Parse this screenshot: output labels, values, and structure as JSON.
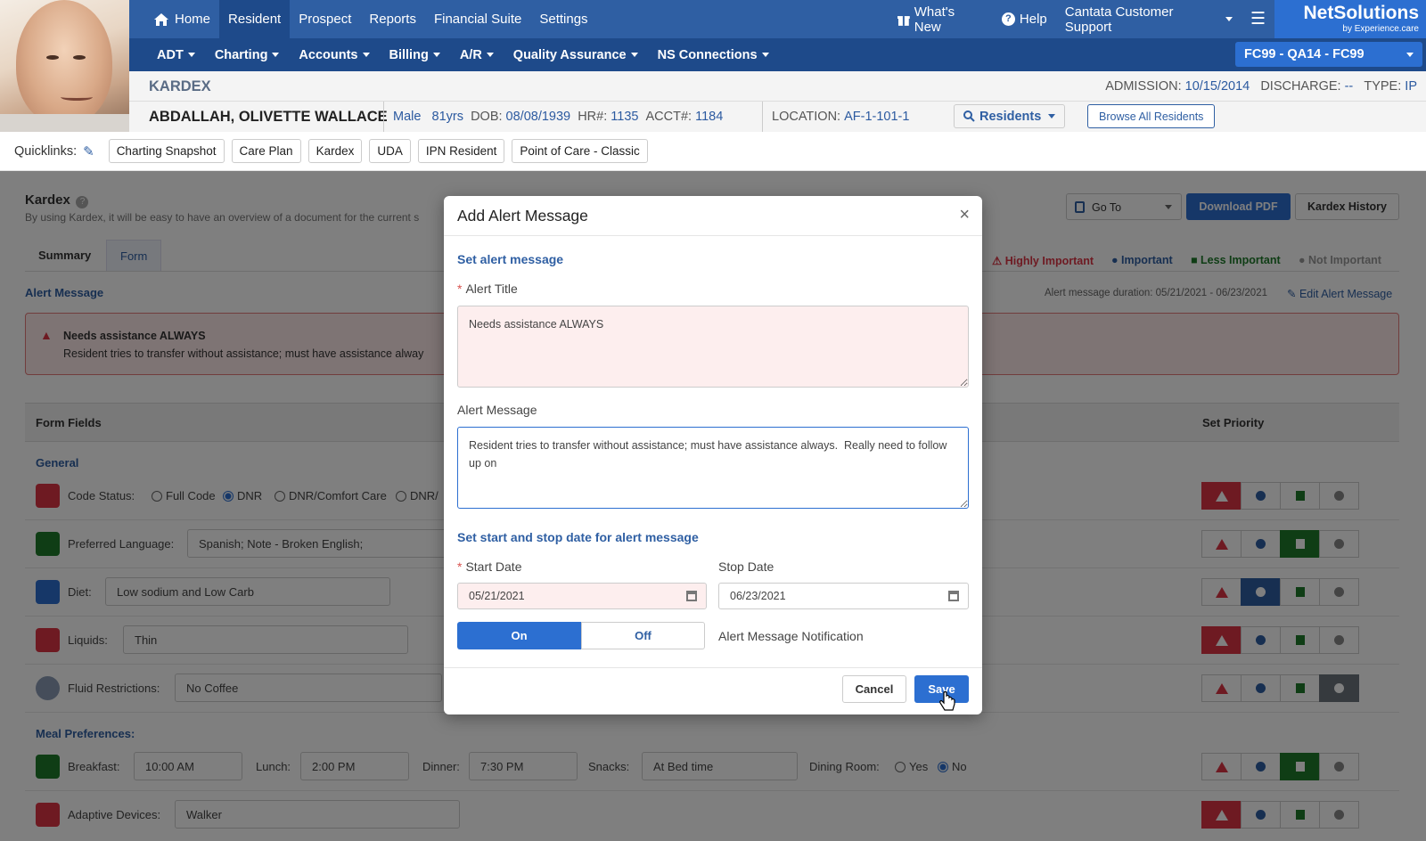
{
  "nav": {
    "top": [
      "Home",
      "Resident",
      "Prospect",
      "Reports",
      "Financial Suite",
      "Settings"
    ],
    "right": {
      "whats_new": "What's New",
      "help": "Help",
      "support": "Cantata Customer Support"
    },
    "sub": [
      "ADT",
      "Charting",
      "Accounts",
      "Billing",
      "A/R",
      "Quality Assurance",
      "NS Connections"
    ]
  },
  "logo": {
    "main": "NetSolutions",
    "sub": "by Experience.care"
  },
  "facility": "FC99 - QA14 - FC99",
  "kardex": {
    "title": "KARDEX",
    "admission_label": "ADMISSION:",
    "admission": "10/15/2014",
    "discharge_label": "DISCHARGE:",
    "discharge": "--",
    "type_label": "TYPE:",
    "type": "IP"
  },
  "patient": {
    "name": "ABDALLAH, OLIVETTE WALLACE",
    "sex": "Male",
    "age": "81yrs",
    "dob_label": "DOB:",
    "dob": "08/08/1939",
    "hr_label": "HR#:",
    "hr": "1135",
    "acct_label": "ACCT#:",
    "acct": "1184",
    "loc_label": "LOCATION:",
    "loc": "AF-1-101-1",
    "residents_btn": "Residents",
    "browse_btn": "Browse All Residents"
  },
  "quicklinks": {
    "label": "Quicklinks:",
    "items": [
      "Charting Snapshot",
      "Care Plan",
      "Kardex",
      "UDA",
      "IPN Resident",
      "Point of Care - Classic"
    ]
  },
  "page": {
    "title": "Kardex",
    "desc": "By using Kardex, it will be easy to have an overview of a document for the current s",
    "goto": "Go To",
    "download": "Download PDF",
    "history": "Kardex History",
    "tabs": [
      "Summary",
      "Form"
    ],
    "legend": [
      "Highly Important",
      "Important",
      "Less Important",
      "Not Important"
    ],
    "alert_section": "Alert Message",
    "duration": "Alert message duration: 05/21/2021 - 06/23/2021",
    "edit_alert": "Edit Alert Message",
    "alert_title": "Needs assistance ALWAYS",
    "alert_text": "Resident tries to transfer without assistance; must have assistance alway",
    "form_fields": "Form Fields",
    "set_priority": "Set Priority",
    "general": "General",
    "meal": "Meal Preferences:"
  },
  "fields": {
    "code_status": {
      "label": "Code Status:",
      "options": [
        "Full Code",
        "DNR",
        "DNR/Comfort Care",
        "DNR/"
      ]
    },
    "language": {
      "label": "Preferred Language:",
      "value": "Spanish; Note - Broken English;"
    },
    "diet": {
      "label": "Diet:",
      "value": "Low sodium and Low Carb"
    },
    "liquids": {
      "label": "Liquids:",
      "value": "Thin"
    },
    "fluid": {
      "label": "Fluid Restrictions:",
      "value": "No Coffee"
    },
    "breakfast": {
      "label": "Breakfast:",
      "value": "10:00 AM",
      "lunch_label": "Lunch:",
      "lunch": "2:00 PM",
      "dinner_label": "Dinner:",
      "dinner": "7:30 PM",
      "snacks_label": "Snacks:",
      "snacks": "At Bed time",
      "dining_label": "Dining Room:",
      "yes": "Yes",
      "no": "No"
    },
    "adaptive": {
      "label": "Adaptive Devices:",
      "value": "Walker"
    }
  },
  "priorities": [
    "highly",
    "less",
    "important",
    "highly",
    "not",
    "less",
    "highly"
  ],
  "modal": {
    "title": "Add Alert Message",
    "section1": "Set alert message",
    "title_label": "Alert Title",
    "title_value": "Needs assistance ALWAYS",
    "message_label": "Alert Message",
    "message_value": "Resident tries to transfer without assistance; must have assistance always.  Really need to follow up on",
    "section2": "Set start and stop date for alert message",
    "start_label": "Start Date",
    "start": "05/21/2021",
    "stop_label": "Stop Date",
    "stop": "06/23/2021",
    "on": "On",
    "off": "Off",
    "notif": "Alert Message Notification",
    "cancel": "Cancel",
    "save": "Save"
  },
  "colors": {
    "primary": "#2f5fa3",
    "nav_dark": "#1e4a8a",
    "accent": "#2c6fd1",
    "danger": "#dc3545",
    "success": "#1f7a2a"
  }
}
